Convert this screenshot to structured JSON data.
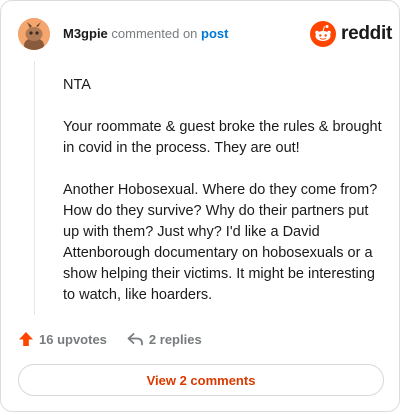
{
  "comment": {
    "username": "M3gpie",
    "commented_text": "commented on",
    "post_link_label": "post",
    "brand": "reddit",
    "paragraphs": [
      "NTA",
      "Your roommate & guest broke the rules & brought in covid in the process. They are out!",
      "Another Hobosexual. Where do they come from? How do they survive? Why do their partners put up with them? Just why? I'd like a David Attenborough documentary on hobosexuals or a show helping their victims. It might be interesting to watch, like hoarders."
    ],
    "upvotes_label": "16 upvotes",
    "replies_label": "2 replies",
    "view_comments_label": "View 2 comments"
  },
  "colors": {
    "brand": "#ff4500",
    "link": "#0079d3",
    "accent_text": "#d93a00",
    "muted": "#787c7e"
  },
  "icons": {
    "avatar": "snoo-avatar",
    "logo": "reddit-snoo-icon",
    "upvote": "upvote-arrow-icon",
    "reply": "reply-arrow-icon"
  }
}
